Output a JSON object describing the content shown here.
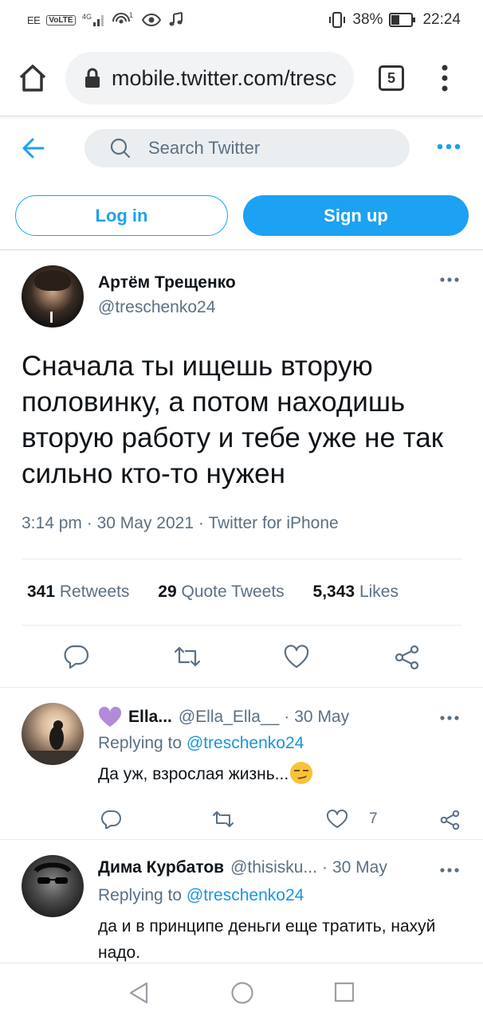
{
  "status_bar": {
    "carrier": "EE",
    "volte": "VoLTE",
    "network": "4G",
    "notification_count": "1",
    "battery": "38%",
    "time": "22:24"
  },
  "browser": {
    "url": "mobile.twitter.com/tresc",
    "tab_count": "5"
  },
  "twitter_header": {
    "search_placeholder": "Search Twitter"
  },
  "auth": {
    "login_label": "Log in",
    "signup_label": "Sign up"
  },
  "tweet": {
    "author_name": "Артём Трещенко",
    "author_handle": "@treschenko24",
    "text": "Сначала ты ищешь вторую половинку, а потом находишь вторую работу и тебе уже не так сильно кто-то нужен",
    "time": "3:14 pm",
    "date": "30 May 2021",
    "source": "Twitter for iPhone",
    "separator": "·",
    "stats": {
      "retweets_count": "341",
      "retweets_label": "Retweets",
      "quotes_count": "29",
      "quotes_label": "Quote Tweets",
      "likes_count": "5,343",
      "likes_label": "Likes"
    }
  },
  "replies": [
    {
      "name": "Ella...",
      "handle": "@Ella_Ella__",
      "date": "30 May",
      "replying_prefix": "Replying to",
      "replying_to": "@treschenko24",
      "text": "Да уж, взрослая жизнь...",
      "likes": "7"
    },
    {
      "name": "Дима Курбатов",
      "handle": "@thisisku...",
      "date": "30 May",
      "replying_prefix": "Replying to",
      "replying_to": "@treschenko24",
      "text": "да и в принципе деньги еще тратить, нахуй надо."
    }
  ],
  "colors": {
    "twitter_blue": "#1da1f2",
    "mention_blue": "#1b95e0",
    "secondary_text": "#5b7083",
    "heart_purple": "#b28bd8"
  }
}
